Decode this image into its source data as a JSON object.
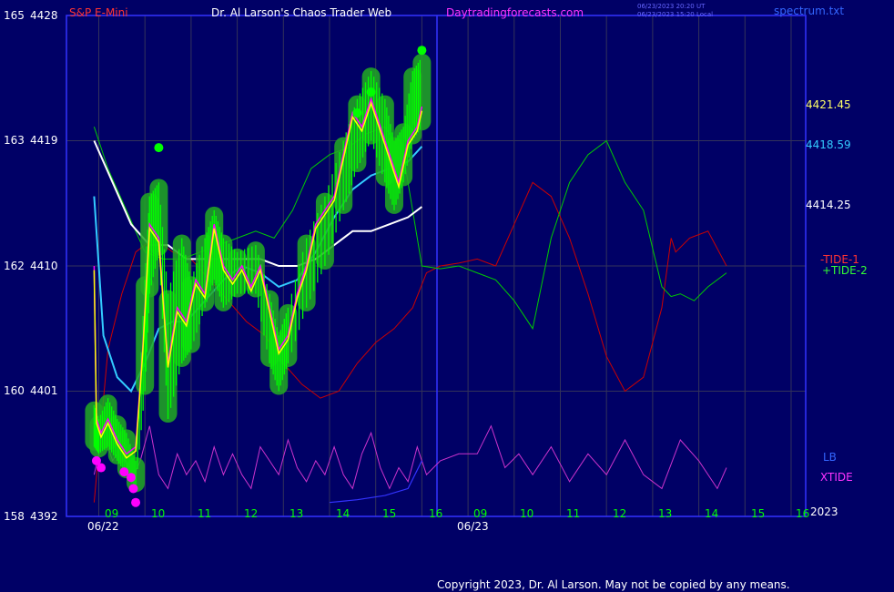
{
  "header": {
    "symbol": "S&P E-Mini",
    "title": "Dr. Al Larson's Chaos Trader Web",
    "site": "Daytradingforecasts.com",
    "stamp_line1": "06/23/2023 20:20 UT",
    "stamp_line2": "06/23/2023 15:20 Local",
    "file": "spectrum.txt"
  },
  "footer": {
    "copyright": "Copyright 2023, Dr. Al Larson. May not be copied by any means."
  },
  "colors": {
    "background": "#000066",
    "grid": "#33335a",
    "frame": "#3333ff",
    "candles": "#00ff00",
    "price_line": "#ffff00",
    "ma_fast": "#ff00ff",
    "ma_cyan": "#33ccff",
    "ma_white": "#ffffff",
    "tide1": "#cc0000",
    "tide2": "#00cc00",
    "xtide": "#cc33cc",
    "label_green": "#00ff00",
    "label_yellow": "#ffff66",
    "label_cyan": "#33ccff"
  },
  "chart_data": {
    "type": "line",
    "y_axis": {
      "range": [
        4392,
        4428
      ],
      "ticks": [
        {
          "cycle": "165",
          "price": 4428
        },
        {
          "cycle": "163",
          "price": 4419
        },
        {
          "cycle": "162",
          "price": 4410
        },
        {
          "cycle": "160",
          "price": 4401
        },
        {
          "cycle": "158",
          "price": 4392
        }
      ]
    },
    "x_axis": {
      "hour_labels": [
        "09",
        "10",
        "11",
        "12",
        "13",
        "14",
        "15",
        "16",
        "09",
        "10",
        "11",
        "12",
        "13",
        "14",
        "15",
        "16"
      ],
      "dates": [
        "06/22",
        "06/23"
      ],
      "year": "2023"
    },
    "right_labels": [
      {
        "text": "4421.45",
        "color": "yellow"
      },
      {
        "text": "4418.59",
        "color": "cyan"
      },
      {
        "text": "4414.25",
        "color": "white"
      }
    ],
    "series_labels": [
      {
        "text": "-TIDE-1",
        "color": "red"
      },
      {
        "text": "+TIDE-2",
        "color": "green"
      },
      {
        "text": "LB",
        "color": "blue"
      },
      {
        "text": "XTIDE",
        "color": "magenta"
      }
    ],
    "series": [
      {
        "id": "price_high",
        "values": [
          [
            8.9,
            4400
          ],
          [
            9.0,
            4399
          ],
          [
            9.2,
            4400.5
          ],
          [
            9.4,
            4399
          ],
          [
            9.6,
            4398
          ],
          [
            9.8,
            4396
          ],
          [
            10.0,
            4409
          ],
          [
            10.1,
            4415
          ],
          [
            10.3,
            4416
          ],
          [
            10.5,
            4408
          ],
          [
            10.8,
            4412
          ],
          [
            11.0,
            4409
          ],
          [
            11.3,
            4412
          ],
          [
            11.5,
            4414
          ],
          [
            11.7,
            4412
          ],
          [
            12.0,
            4411
          ],
          [
            12.4,
            4411.5
          ],
          [
            12.7,
            4408
          ],
          [
            12.9,
            4405
          ],
          [
            13.1,
            4407
          ],
          [
            13.5,
            4412
          ],
          [
            13.9,
            4415
          ],
          [
            14.3,
            4419
          ],
          [
            14.6,
            4422
          ],
          [
            14.9,
            4424
          ],
          [
            15.2,
            4422
          ],
          [
            15.4,
            4419
          ],
          [
            15.6,
            4420
          ],
          [
            15.8,
            4424
          ],
          [
            16.0,
            4425
          ]
        ]
      },
      {
        "id": "price_low",
        "values": [
          [
            8.9,
            4397
          ],
          [
            9.0,
            4396.5
          ],
          [
            9.2,
            4397
          ],
          [
            9.4,
            4396
          ],
          [
            9.6,
            4395
          ],
          [
            9.8,
            4394
          ],
          [
            10.0,
            4401
          ],
          [
            10.1,
            4408
          ],
          [
            10.3,
            4411
          ],
          [
            10.5,
            4399
          ],
          [
            10.8,
            4403
          ],
          [
            11.0,
            4404
          ],
          [
            11.3,
            4407
          ],
          [
            11.5,
            4409
          ],
          [
            11.7,
            4407
          ],
          [
            12.0,
            4408
          ],
          [
            12.4,
            4408
          ],
          [
            12.7,
            4403
          ],
          [
            12.9,
            4401
          ],
          [
            13.1,
            4403
          ],
          [
            13.5,
            4407
          ],
          [
            13.9,
            4410
          ],
          [
            14.3,
            4414
          ],
          [
            14.6,
            4417
          ],
          [
            14.9,
            4419
          ],
          [
            15.2,
            4416
          ],
          [
            15.4,
            4414
          ],
          [
            15.6,
            4416
          ],
          [
            15.8,
            4419
          ],
          [
            16.0,
            4420
          ]
        ]
      },
      {
        "id": "price_close",
        "values": [
          [
            8.9,
            4410
          ],
          [
            8.95,
            4399
          ],
          [
            9.05,
            4398
          ],
          [
            9.2,
            4399
          ],
          [
            9.4,
            4397.5
          ],
          [
            9.6,
            4396.5
          ],
          [
            9.8,
            4397
          ],
          [
            9.95,
            4404
          ],
          [
            10.1,
            4413
          ],
          [
            10.3,
            4412
          ],
          [
            10.5,
            4403
          ],
          [
            10.7,
            4407
          ],
          [
            10.9,
            4406
          ],
          [
            11.1,
            4409
          ],
          [
            11.3,
            4408
          ],
          [
            11.5,
            4413
          ],
          [
            11.7,
            4410
          ],
          [
            11.9,
            4409
          ],
          [
            12.1,
            4410
          ],
          [
            12.3,
            4408.5
          ],
          [
            12.5,
            4410
          ],
          [
            12.7,
            4407
          ],
          [
            12.9,
            4404
          ],
          [
            13.1,
            4405
          ],
          [
            13.3,
            4408
          ],
          [
            13.5,
            4410
          ],
          [
            13.7,
            4413
          ],
          [
            13.9,
            4414
          ],
          [
            14.1,
            4415
          ],
          [
            14.3,
            4418
          ],
          [
            14.5,
            4421
          ],
          [
            14.7,
            4420
          ],
          [
            14.9,
            4422
          ],
          [
            15.1,
            4420
          ],
          [
            15.3,
            4418
          ],
          [
            15.5,
            4416
          ],
          [
            15.7,
            4419
          ],
          [
            15.9,
            4420
          ],
          [
            16.0,
            4421.45
          ]
        ]
      },
      {
        "id": "ma_cyan",
        "values": [
          [
            8.9,
            4415
          ],
          [
            9.1,
            4405
          ],
          [
            9.4,
            4402
          ],
          [
            9.7,
            4401
          ],
          [
            10.0,
            4403
          ],
          [
            10.3,
            4405.5
          ],
          [
            10.6,
            4406
          ],
          [
            10.9,
            4406
          ],
          [
            11.3,
            4407.5
          ],
          [
            11.7,
            4409
          ],
          [
            12.1,
            4410
          ],
          [
            12.5,
            4409.5
          ],
          [
            12.9,
            4408.5
          ],
          [
            13.3,
            4409
          ],
          [
            13.7,
            4411
          ],
          [
            14.1,
            4413.5
          ],
          [
            14.5,
            4415.5
          ],
          [
            14.9,
            4416.5
          ],
          [
            15.3,
            4417
          ],
          [
            15.7,
            4417.5
          ],
          [
            16.0,
            4418.59
          ]
        ]
      },
      {
        "id": "ma_white",
        "values": [
          [
            8.9,
            4419
          ],
          [
            9.3,
            4416
          ],
          [
            9.7,
            4413
          ],
          [
            10.1,
            4411.5
          ],
          [
            10.5,
            4411.5
          ],
          [
            10.9,
            4410.5
          ],
          [
            11.3,
            4410.5
          ],
          [
            11.7,
            4410.5
          ],
          [
            12.1,
            4410.5
          ],
          [
            12.5,
            4410.5
          ],
          [
            12.9,
            4410
          ],
          [
            13.3,
            4410
          ],
          [
            13.7,
            4410.5
          ],
          [
            14.1,
            4411.5
          ],
          [
            14.5,
            4412.5
          ],
          [
            14.9,
            4412.5
          ],
          [
            15.3,
            4413
          ],
          [
            15.7,
            4413.5
          ],
          [
            16.0,
            4414.25
          ]
        ]
      },
      {
        "id": "tide1",
        "values": [
          [
            8.9,
            4393
          ],
          [
            9.2,
            4404
          ],
          [
            9.5,
            4408
          ],
          [
            9.8,
            4411
          ],
          [
            10.2,
            4412
          ],
          [
            10.6,
            4411
          ],
          [
            11.0,
            4410.5
          ],
          [
            11.4,
            4409
          ],
          [
            11.8,
            4407.5
          ],
          [
            12.2,
            4406
          ],
          [
            12.6,
            4405
          ],
          [
            13.0,
            4403
          ],
          [
            13.4,
            4401.5
          ],
          [
            13.8,
            4400.5
          ],
          [
            14.2,
            4401
          ],
          [
            14.6,
            4403
          ],
          [
            15.0,
            4404.5
          ],
          [
            15.4,
            4405.5
          ],
          [
            15.8,
            4407
          ],
          [
            16.1,
            4409.5
          ],
          [
            16.4,
            4410
          ],
          [
            16.8,
            4410.2
          ],
          [
            17.2,
            4410.5
          ],
          [
            17.6,
            4410
          ],
          [
            18.0,
            4413
          ],
          [
            18.4,
            4416
          ],
          [
            18.8,
            4415
          ],
          [
            19.2,
            4412
          ],
          [
            19.6,
            4408
          ],
          [
            20.0,
            4403.5
          ],
          [
            20.4,
            4401
          ],
          [
            20.8,
            4402
          ],
          [
            21.2,
            4407
          ],
          [
            21.4,
            4412
          ],
          [
            21.5,
            4411
          ],
          [
            21.8,
            4412
          ],
          [
            22.2,
            4412.5
          ],
          [
            22.6,
            4410
          ]
        ]
      },
      {
        "id": "tide2",
        "values": [
          [
            8.9,
            4420
          ],
          [
            9.2,
            4417
          ],
          [
            9.6,
            4414
          ],
          [
            10.0,
            4411
          ],
          [
            10.4,
            4410.5
          ],
          [
            10.8,
            4410.5
          ],
          [
            11.2,
            4411
          ],
          [
            11.6,
            4411.5
          ],
          [
            12.0,
            4412
          ],
          [
            12.4,
            4412.5
          ],
          [
            12.8,
            4412
          ],
          [
            13.2,
            4414
          ],
          [
            13.6,
            4417
          ],
          [
            14.0,
            4418
          ],
          [
            14.4,
            4418.5
          ],
          [
            14.8,
            4419.5
          ],
          [
            15.2,
            4420
          ],
          [
            15.6,
            4418
          ],
          [
            16.0,
            4410
          ],
          [
            16.4,
            4409.8
          ],
          [
            16.8,
            4410
          ],
          [
            17.2,
            4409.5
          ],
          [
            17.6,
            4409
          ],
          [
            18.0,
            4407.5
          ],
          [
            18.4,
            4405.5
          ],
          [
            18.8,
            4412
          ],
          [
            19.2,
            4416
          ],
          [
            19.6,
            4418
          ],
          [
            20.0,
            4419
          ],
          [
            20.4,
            4416
          ],
          [
            20.8,
            4414
          ],
          [
            21.2,
            4408.5
          ],
          [
            21.4,
            4407.8
          ],
          [
            21.6,
            4408
          ],
          [
            21.9,
            4407.5
          ],
          [
            22.2,
            4408.5
          ],
          [
            22.6,
            4409.5
          ]
        ]
      },
      {
        "id": "xtide",
        "values": [
          [
            8.9,
            4395
          ],
          [
            9.1,
            4398
          ],
          [
            9.3,
            4396
          ],
          [
            9.5,
            4397
          ],
          [
            9.7,
            4394.5
          ],
          [
            9.9,
            4396
          ],
          [
            10.1,
            4398.5
          ],
          [
            10.3,
            4395
          ],
          [
            10.5,
            4394
          ],
          [
            10.7,
            4396.5
          ],
          [
            10.9,
            4395
          ],
          [
            11.1,
            4396
          ],
          [
            11.3,
            4394.5
          ],
          [
            11.5,
            4397
          ],
          [
            11.7,
            4395
          ],
          [
            11.9,
            4396.5
          ],
          [
            12.1,
            4395
          ],
          [
            12.3,
            4394
          ],
          [
            12.5,
            4397
          ],
          [
            12.7,
            4396
          ],
          [
            12.9,
            4395
          ],
          [
            13.1,
            4397.5
          ],
          [
            13.3,
            4395.5
          ],
          [
            13.5,
            4394.5
          ],
          [
            13.7,
            4396
          ],
          [
            13.9,
            4395
          ],
          [
            14.1,
            4397
          ],
          [
            14.3,
            4395
          ],
          [
            14.5,
            4394
          ],
          [
            14.7,
            4396.5
          ],
          [
            14.9,
            4398
          ],
          [
            15.1,
            4395.5
          ],
          [
            15.3,
            4394
          ],
          [
            15.5,
            4395.5
          ],
          [
            15.7,
            4394.5
          ],
          [
            15.9,
            4397
          ],
          [
            16.1,
            4395
          ],
          [
            16.4,
            4396
          ],
          [
            16.8,
            4396.5
          ],
          [
            17.2,
            4396.5
          ],
          [
            17.5,
            4398.5
          ],
          [
            17.8,
            4395.5
          ],
          [
            18.1,
            4396.5
          ],
          [
            18.4,
            4395
          ],
          [
            18.8,
            4397
          ],
          [
            19.2,
            4394.5
          ],
          [
            19.6,
            4396.5
          ],
          [
            20.0,
            4395
          ],
          [
            20.4,
            4397.5
          ],
          [
            20.8,
            4395
          ],
          [
            21.2,
            4394
          ],
          [
            21.6,
            4397.5
          ],
          [
            22.0,
            4396
          ],
          [
            22.4,
            4394
          ],
          [
            22.6,
            4395.5
          ]
        ]
      },
      {
        "id": "lb",
        "values": [
          [
            14.0,
            4393
          ],
          [
            14.6,
            4393.2
          ],
          [
            15.2,
            4393.5
          ],
          [
            15.7,
            4394
          ],
          [
            16.0,
            4396
          ]
        ]
      }
    ]
  }
}
